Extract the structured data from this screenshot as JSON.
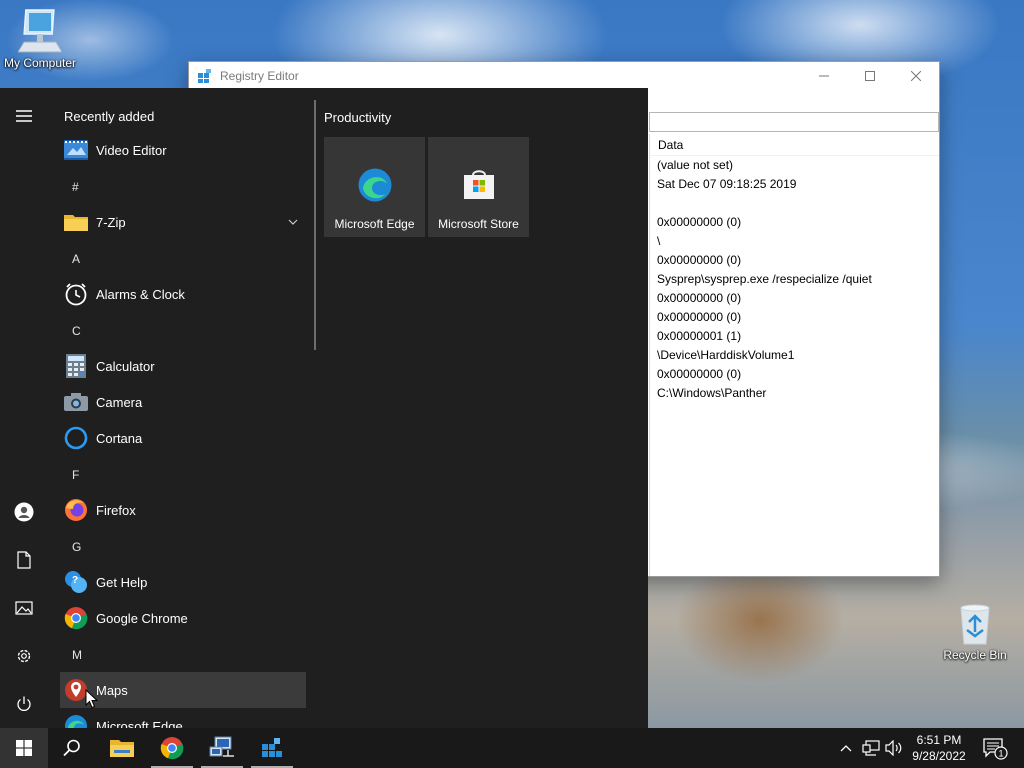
{
  "desktop": {
    "icons": [
      {
        "label": "My Computer",
        "icon": "computer-icon"
      },
      {
        "label": "Recycle Bin",
        "icon": "recycle-bin-icon"
      }
    ]
  },
  "registry_window": {
    "title": "Registry Editor",
    "column_header": "Data",
    "data_rows": [
      "(value not set)",
      "Sat Dec 07 09:18:25 2019",
      "",
      "0x00000000 (0)",
      "\\",
      "0x00000000 (0)",
      "Sysprep\\sysprep.exe /respecialize /quiet",
      "0x00000000 (0)",
      "0x00000000 (0)",
      "0x00000001 (1)",
      "\\Device\\HarddiskVolume1",
      "0x00000000 (0)",
      "C:\\Windows\\Panther"
    ]
  },
  "start_menu": {
    "recently_added_header": "Recently added",
    "recently_added": [
      {
        "label": "Video Editor",
        "icon": "video-editor-icon"
      }
    ],
    "groups": [
      {
        "letter": "#",
        "apps": [
          {
            "label": "7-Zip",
            "icon": "folder-icon",
            "expandable": true
          }
        ]
      },
      {
        "letter": "A",
        "apps": [
          {
            "label": "Alarms & Clock",
            "icon": "alarm-clock-icon"
          }
        ]
      },
      {
        "letter": "C",
        "apps": [
          {
            "label": "Calculator",
            "icon": "calculator-icon"
          },
          {
            "label": "Camera",
            "icon": "camera-icon"
          },
          {
            "label": "Cortana",
            "icon": "cortana-icon"
          }
        ]
      },
      {
        "letter": "F",
        "apps": [
          {
            "label": "Firefox",
            "icon": "firefox-icon"
          }
        ]
      },
      {
        "letter": "G",
        "apps": [
          {
            "label": "Get Help",
            "icon": "get-help-icon"
          },
          {
            "label": "Google Chrome",
            "icon": "chrome-icon"
          }
        ]
      },
      {
        "letter": "M",
        "apps": [
          {
            "label": "Maps",
            "icon": "maps-icon",
            "highlighted": true
          },
          {
            "label": "Microsoft Edge",
            "icon": "edge-icon"
          }
        ]
      }
    ],
    "tiles_header": "Productivity",
    "tiles": [
      {
        "label": "Microsoft Edge",
        "icon": "edge-icon"
      },
      {
        "label": "Microsoft Store",
        "icon": "store-icon"
      }
    ],
    "rail": [
      "hamburger-menu-icon",
      "user-icon",
      "documents-icon",
      "pictures-icon",
      "settings-icon",
      "power-icon"
    ]
  },
  "taskbar": {
    "apps": [
      "search-icon",
      "file-explorer-icon",
      "chrome-icon",
      "network-tool-icon",
      "registry-editor-icon"
    ],
    "time": "6:51 PM",
    "date": "9/28/2022",
    "notification_count": "1"
  }
}
